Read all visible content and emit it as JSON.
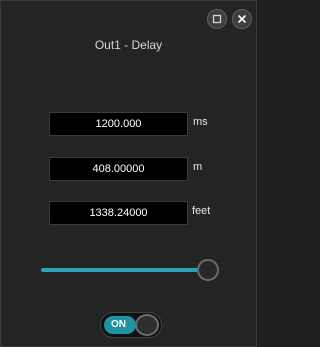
{
  "window": {
    "subtitle": "Out1 - Delay"
  },
  "delay": {
    "ms": {
      "value": "1200.000",
      "unit": "ms"
    },
    "meters": {
      "value": "408.00000",
      "unit": "m"
    },
    "feet": {
      "value": "1338.24000",
      "unit": "feet"
    }
  },
  "slider": {
    "level": 1.0
  },
  "toggle": {
    "label": "ON",
    "state": "on"
  },
  "colors": {
    "accent": "#2aa3b6",
    "background": "#232524",
    "field": "#000000"
  },
  "icons": {
    "maximize": "square-icon",
    "close": "close-icon"
  }
}
